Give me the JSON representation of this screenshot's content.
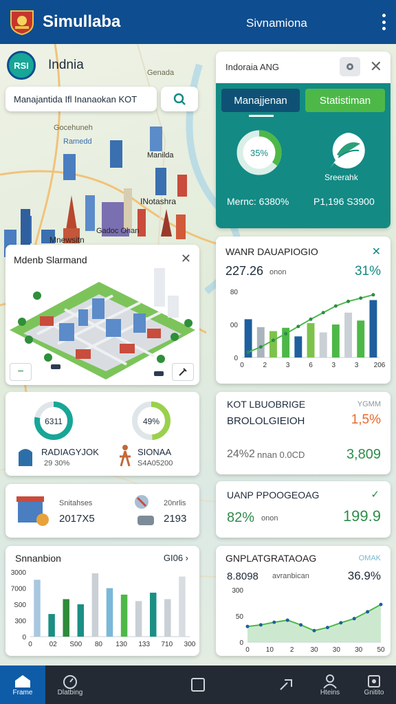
{
  "appbar": {
    "title": "Simullaba",
    "subtitle": "Sivnamiona"
  },
  "location": {
    "badge": "RSI",
    "name": "Indnia"
  },
  "search": {
    "value": "Manajantida Ifl Inanaokan KOT"
  },
  "map_labels": [
    "Genada",
    "Gocehuneh",
    "Ramedd",
    "Manilda",
    "INotashra",
    "Mnewsitn",
    "Gadoc Ohan"
  ],
  "top_panel": {
    "header": "Indoraia ANG",
    "tab_a": "Manajjenan",
    "tab_b": "Statistiman",
    "ring_pct": "35%",
    "ring_value": 0.35,
    "icon_label": "Sreerahk",
    "stat_left": "Mernc: 6380%",
    "stat_right": "P1,196 S3900"
  },
  "city_panel": {
    "title": "Mdenb Slarmand"
  },
  "growth_chart": {
    "title": "WANR DAUAPIOGIO",
    "value": "227.26",
    "value_unit": "onon",
    "pct": "31%"
  },
  "donut_card": {
    "left_value": "6311",
    "left_fraction": 0.78,
    "left_label": "RADIAGYJOK",
    "left_sub": "29 30%",
    "right_value": "49%",
    "right_fraction": 0.49,
    "right_label": "SIONAA",
    "right_sub": "S4A05200"
  },
  "kpi_card": {
    "line1": "KOT LBUOBRIGE",
    "line1_right": "YGMM",
    "line2": "BROLOLGIEIOH",
    "pct": "1,5%",
    "bottom_left": "24%2",
    "bottom_unit": "nnan 0.0CD",
    "bottom_right": "3,809"
  },
  "small_stats": {
    "left_label": "Snitahses",
    "left_value": "2017X5",
    "right_label": "20nrlis",
    "right_value": "2193"
  },
  "progress_card": {
    "title": "UANP PPOOGEOAG",
    "pct": "82%",
    "unit": "onon",
    "value": "199.9"
  },
  "colors": {
    "navy": "#0e4d8f",
    "teal": "#138a84",
    "green": "#4db848",
    "orange": "#e8692a"
  },
  "bar_card": {
    "title": "Snnanbion",
    "right": "GI06"
  },
  "area_card": {
    "title": "GNPLATGRATAOAG",
    "right_top": "OMAK",
    "value": "8.8098",
    "unit": "avranbican",
    "pct": "36.9%"
  },
  "chart_data": [
    {
      "type": "bar",
      "title": "WANR DAUAPIOGIO",
      "x_ticks": [
        "0",
        "2",
        "3",
        "6",
        "3",
        "3",
        "206"
      ],
      "y_ticks": [
        "0",
        "00",
        "80"
      ],
      "ylim": [
        0,
        100
      ],
      "series": [
        {
          "values": [
            58,
            46,
            40,
            45,
            32,
            52,
            38,
            50,
            68,
            56,
            87
          ]
        }
      ],
      "trend": [
        8,
        16,
        26,
        36,
        47,
        58,
        68,
        78,
        85,
        90,
        95
      ]
    },
    {
      "type": "bar",
      "title": "Snnanbion",
      "x_ticks": [
        "0",
        "02",
        "S00",
        "80",
        "130",
        "133",
        "710",
        "300"
      ],
      "y_ticks": [
        "0",
        "300",
        "S00",
        "7000",
        "3000"
      ],
      "ylim": [
        0,
        100
      ],
      "series": [
        {
          "values": [
            88,
            35,
            58,
            50,
            98,
            75,
            65,
            55,
            68,
            58,
            93
          ]
        }
      ]
    },
    {
      "type": "line",
      "title": "GNPLATGRATAOAG",
      "x_ticks": [
        "0",
        "10",
        "2",
        "30",
        "30",
        "30",
        "50"
      ],
      "y_ticks": [
        "0",
        "50",
        "300"
      ],
      "ylim": [
        0,
        100
      ],
      "series": [
        {
          "values": [
            30,
            33,
            38,
            42,
            33,
            22,
            28,
            37,
            45,
            58,
            72
          ]
        }
      ]
    }
  ],
  "nav": {
    "items": [
      {
        "label": "Frame"
      },
      {
        "label": "Dlatbing"
      },
      {
        "label": ""
      },
      {
        "label": ""
      },
      {
        "label": "Hteins"
      },
      {
        "label": "Gnitito"
      }
    ]
  }
}
